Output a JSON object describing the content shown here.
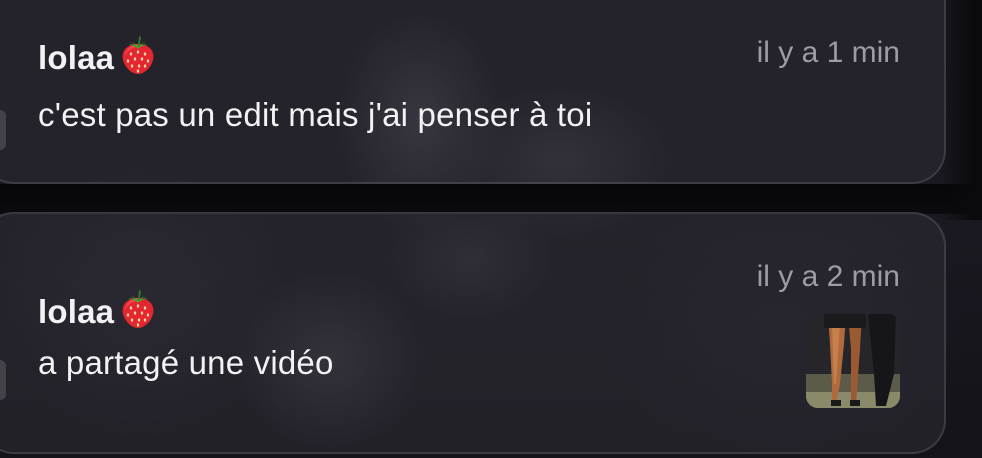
{
  "notifications": [
    {
      "sender": "lolaa",
      "sender_emoji": "strawberry-icon",
      "time": "il y a 1 min",
      "message": "c'est pas un edit mais j'ai penser à toi"
    },
    {
      "sender": "lolaa",
      "sender_emoji": "strawberry-icon",
      "time": "il y a 2 min",
      "message": "a partagé une vidéo",
      "attachment": "video-thumbnail"
    }
  ],
  "colors": {
    "card_bg": "#2c2a32",
    "text_primary": "#f2f2f4",
    "text_secondary": "#9d9ca3",
    "strawberry": "#e3262f"
  }
}
